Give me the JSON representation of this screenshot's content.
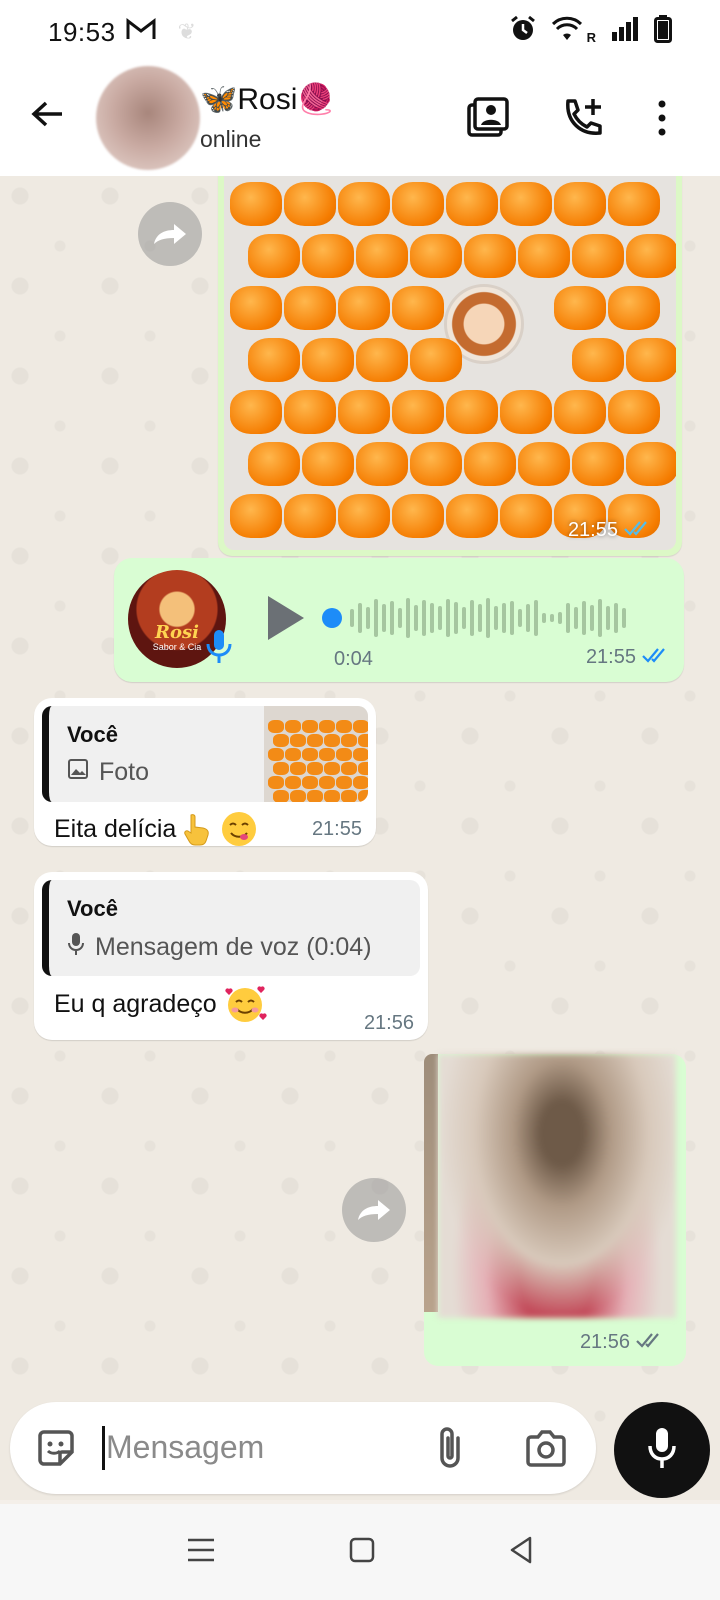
{
  "status_bar": {
    "time": "19:53",
    "mail_icon": "gmail-icon",
    "network_label": "R"
  },
  "header": {
    "contact_name": "🦋Rosi🧶",
    "status": "online"
  },
  "messages": {
    "photo1": {
      "time": "21:55"
    },
    "voice": {
      "duration": "0:04",
      "time": "21:55",
      "avatar_title": "Rosi",
      "avatar_subtitle": "Sabor & Cia"
    },
    "reply1": {
      "quote_author": "Você",
      "quote_text": "Foto",
      "text": "Eita delícia",
      "time": "21:55"
    },
    "reply2": {
      "quote_author": "Você",
      "quote_text": "Mensagem de voz (0:04)",
      "text": "Eu q agradeço",
      "time": "21:56"
    },
    "photo2": {
      "time": "21:56"
    }
  },
  "composer": {
    "placeholder": "Mensagem"
  },
  "colors": {
    "outgoing": "#d9fdd3",
    "tick_read": "#53bdeb",
    "accent": "#1d8cf8"
  }
}
